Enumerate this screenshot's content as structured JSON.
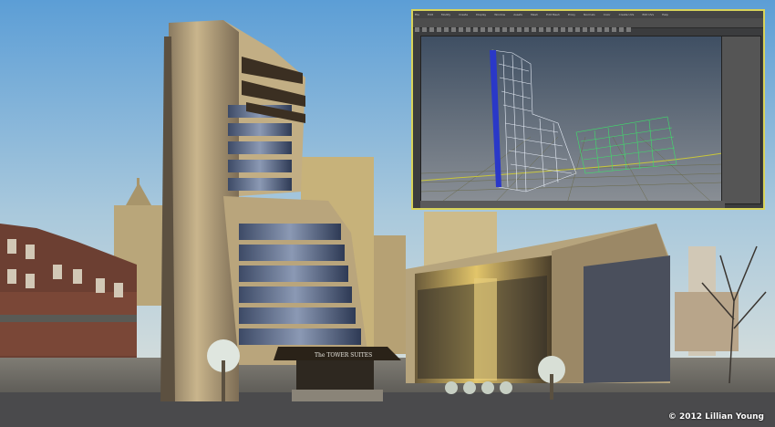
{
  "scene": {
    "sign": "The TOWER SUITES",
    "copyright": "© 2012 Lillian Young"
  },
  "inset": {
    "menu_items": [
      "File",
      "Edit",
      "Modify",
      "Create",
      "Display",
      "Window",
      "Assets",
      "Mesh",
      "Edit Mesh",
      "Proxy",
      "Normals",
      "Color",
      "Create UVs",
      "Edit UVs",
      "Help"
    ]
  },
  "colors": {
    "sky_top": "#6ea7d6",
    "sky_bottom": "#c9dbe3",
    "inset_border": "#d8d35a",
    "wireframe_white": "#e8eef8",
    "wireframe_green": "#3ee06a",
    "wireframe_blue": "#2a38c8"
  }
}
